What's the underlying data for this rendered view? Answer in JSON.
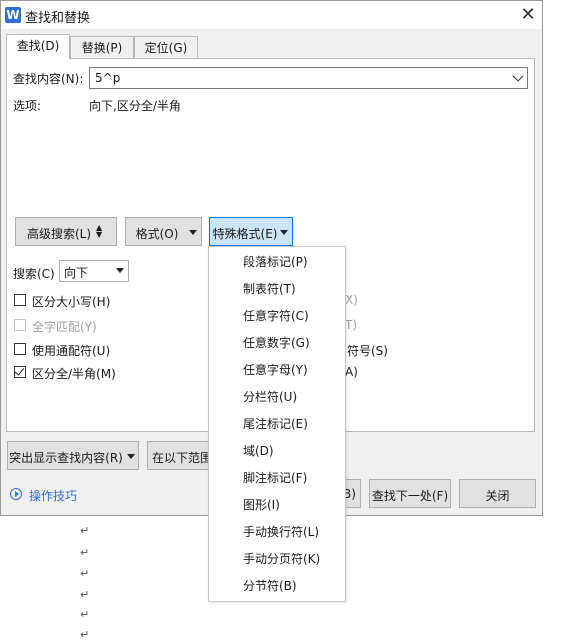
{
  "window": {
    "title": "查找和替换",
    "app_icon": "W"
  },
  "tabs": [
    {
      "label": "查找(D)",
      "active": true
    },
    {
      "label": "替换(P)",
      "active": false
    },
    {
      "label": "定位(G)",
      "active": false
    }
  ],
  "find": {
    "label": "查找内容(N):",
    "value": "5^p"
  },
  "options": {
    "label": "选项:",
    "value": "向下,区分全/半角"
  },
  "buttons": {
    "advanced_search": "高级搜索(L)",
    "format": "格式(O)",
    "special_format": "特殊格式(E)"
  },
  "search": {
    "label": "搜索(C)",
    "value": "向下"
  },
  "checkboxes": [
    {
      "label": "区分大小写(H)",
      "checked": false,
      "disabled": false
    },
    {
      "label": "全字匹配(Y)",
      "checked": false,
      "disabled": true
    },
    {
      "label": "使用通配符(U)",
      "checked": false,
      "disabled": false
    },
    {
      "label": "区分全/半角(M)",
      "checked": true,
      "disabled": false
    }
  ],
  "right_fragments": [
    "X)",
    "T)",
    "符号(S)",
    "A)"
  ],
  "bottom": {
    "highlight": "突出显示查找内容(R)",
    "in_range": "在以下范围",
    "partial_b": "B)",
    "find_next": "查找下一处(F)",
    "close": "关闭"
  },
  "tips": "操作技巧",
  "special_menu": [
    "段落标记(P)",
    "制表符(T)",
    "任意字符(C)",
    "任意数字(G)",
    "任意字母(Y)",
    "分栏符(U)",
    "尾注标记(E)",
    "域(D)",
    "脚注标记(F)",
    "图形(I)",
    "手动换行符(L)",
    "手动分页符(K)",
    "分节符(B)"
  ],
  "doc_paragraph_mark": "↵"
}
